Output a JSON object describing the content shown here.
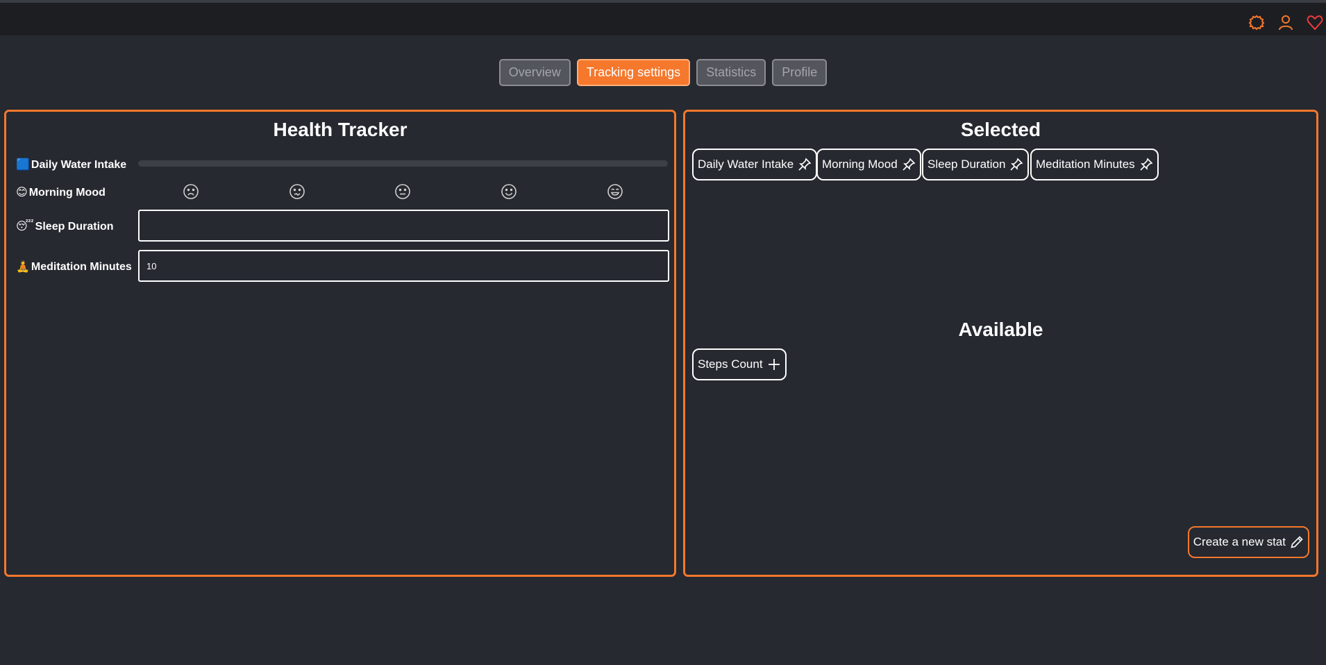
{
  "tabs": [
    {
      "label": "Overview",
      "active": false
    },
    {
      "label": "Tracking settings",
      "active": true
    },
    {
      "label": "Statistics",
      "active": false
    },
    {
      "label": "Profile",
      "active": false
    }
  ],
  "topbar_icons": [
    "settings-icon",
    "user-icon",
    "heart-icon"
  ],
  "tracker": {
    "title": "Health Tracker",
    "water": {
      "emoji": "🟦",
      "label": "Daily Water Intake"
    },
    "mood": {
      "emoji": "😊",
      "label": "Morning Mood",
      "options": [
        "frown",
        "confused",
        "neutral",
        "smile",
        "grin"
      ]
    },
    "sleep": {
      "emoji": "😴",
      "label": "Sleep Duration",
      "value": ""
    },
    "meditation": {
      "emoji": "🧘",
      "label": "Meditation Minutes",
      "value": "10"
    }
  },
  "selected": {
    "title": "Selected",
    "items": [
      "Daily Water Intake",
      "Morning Mood",
      "Sleep Duration",
      "Meditation Minutes"
    ]
  },
  "available": {
    "title": "Available",
    "items": [
      "Steps Count"
    ]
  },
  "create_label": "Create a new stat",
  "colors": {
    "accent": "#f5782d",
    "background": "#262930",
    "topbar": "#1d1e22"
  }
}
